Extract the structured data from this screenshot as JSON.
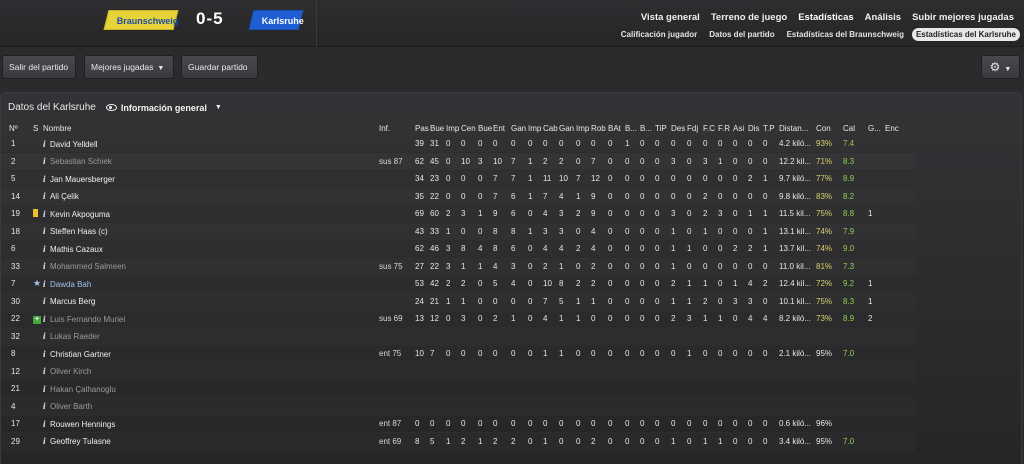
{
  "match": {
    "home_team": "Braunschweig",
    "away_team": "Karlsruhe",
    "score": "0-5",
    "home_color": "#e6d337",
    "away_color": "#1f5ed2"
  },
  "nav": {
    "main": [
      "Vista general",
      "Terreno de juego",
      "Estadísticas",
      "Análisis",
      "Subir mejores jugadas"
    ],
    "main_active": "Estadísticas",
    "sub": [
      "Calificación jugador",
      "Datos del partido",
      "Estadísticas del Braunschweig",
      "Estadísticas del Karlsruhe"
    ],
    "sub_active": "Estadísticas del Karlsruhe"
  },
  "toolbar": {
    "exit_label": "Salir del partido",
    "best_plays_label": "Mejores jugadas",
    "save_label": "Guardar partido",
    "settings_icon": "gear-icon"
  },
  "panel": {
    "title": "Datos del Karlsruhe",
    "view_label": "Información general",
    "view_icon": "eye-icon"
  },
  "table": {
    "columns": [
      "Nº",
      "S",
      "Nombre",
      "Inf.",
      "Pas",
      "Bue",
      "Imp",
      "Cen",
      "Bue",
      "Ent",
      "Gan",
      "Imp",
      "Cab",
      "Gan",
      "Imp",
      "Rob",
      "BAt",
      "B...",
      "B...",
      "TiP",
      "Des",
      "Fdj",
      "F.C",
      "F.R",
      "Asi",
      "Dis",
      "T.P",
      "Distan...",
      "Con",
      "Cal",
      "G...",
      "Enc"
    ],
    "rows": [
      {
        "num": "1",
        "status": "",
        "name": "David Yelldell",
        "style": "normal",
        "inf": "",
        "stats": [
          "39",
          "31",
          "0",
          "0",
          "0",
          "0",
          "0",
          "0",
          "0",
          "0",
          "0",
          "0",
          "0",
          "1",
          "0",
          "0",
          "0",
          "0",
          "0",
          "0",
          "0",
          "0",
          "0"
        ],
        "dist": "4.2 kiló...",
        "con": "93%",
        "con_white": false,
        "cal": "7.4",
        "g": "",
        "enc": ""
      },
      {
        "num": "2",
        "status": "",
        "name": "Sebastian Schiek",
        "style": "dim",
        "inf": "sus 87",
        "stats": [
          "62",
          "45",
          "0",
          "10",
          "3",
          "10",
          "7",
          "1",
          "2",
          "2",
          "0",
          "7",
          "0",
          "0",
          "0",
          "0",
          "3",
          "0",
          "3",
          "1",
          "0",
          "0",
          "0"
        ],
        "dist": "12.2 kil...",
        "con": "71%",
        "con_white": false,
        "cal": "8.3",
        "g": "",
        "enc": ""
      },
      {
        "num": "5",
        "status": "",
        "name": "Jan Mauersberger",
        "style": "normal",
        "inf": "",
        "stats": [
          "34",
          "23",
          "0",
          "0",
          "0",
          "7",
          "7",
          "1",
          "11",
          "10",
          "7",
          "12",
          "0",
          "0",
          "0",
          "0",
          "0",
          "0",
          "0",
          "0",
          "0",
          "2",
          "1"
        ],
        "dist": "9.7 kiló...",
        "con": "77%",
        "con_white": false,
        "cal": "8.9",
        "g": "",
        "enc": ""
      },
      {
        "num": "14",
        "status": "",
        "name": "Ali Çelik",
        "style": "normal",
        "inf": "",
        "stats": [
          "35",
          "22",
          "0",
          "0",
          "0",
          "7",
          "6",
          "1",
          "7",
          "4",
          "1",
          "9",
          "0",
          "0",
          "0",
          "0",
          "0",
          "0",
          "2",
          "0",
          "0",
          "0",
          "0"
        ],
        "dist": "9.8 kiló...",
        "con": "83%",
        "con_white": false,
        "cal": "8.2",
        "g": "",
        "enc": ""
      },
      {
        "num": "19",
        "status": "yellow",
        "name": "Kevin Akpoguma",
        "style": "normal",
        "inf": "",
        "stats": [
          "69",
          "60",
          "2",
          "3",
          "1",
          "9",
          "6",
          "0",
          "4",
          "3",
          "2",
          "9",
          "0",
          "0",
          "0",
          "0",
          "3",
          "0",
          "2",
          "3",
          "0",
          "1",
          "1"
        ],
        "dist": "11.5 kil...",
        "con": "75%",
        "con_white": false,
        "cal": "8.8",
        "g": "1",
        "enc": ""
      },
      {
        "num": "18",
        "status": "",
        "name": "Steffen Haas (c)",
        "style": "normal",
        "inf": "",
        "stats": [
          "43",
          "33",
          "1",
          "0",
          "0",
          "8",
          "8",
          "1",
          "3",
          "3",
          "0",
          "4",
          "0",
          "0",
          "0",
          "0",
          "1",
          "0",
          "1",
          "0",
          "0",
          "0",
          "1"
        ],
        "dist": "13.1 kil...",
        "con": "74%",
        "con_white": false,
        "cal": "7.9",
        "g": "",
        "enc": ""
      },
      {
        "num": "6",
        "status": "",
        "name": "Mathis Cazaux",
        "style": "normal",
        "inf": "",
        "stats": [
          "62",
          "46",
          "3",
          "8",
          "4",
          "8",
          "6",
          "0",
          "4",
          "4",
          "2",
          "4",
          "0",
          "0",
          "0",
          "0",
          "1",
          "1",
          "0",
          "0",
          "2",
          "2",
          "1"
        ],
        "dist": "13.7 kil...",
        "con": "74%",
        "con_white": false,
        "cal": "9.0",
        "g": "",
        "enc": ""
      },
      {
        "num": "33",
        "status": "",
        "name": "Mohammed Salmeen",
        "style": "dim",
        "inf": "sus 75",
        "stats": [
          "27",
          "22",
          "3",
          "1",
          "1",
          "4",
          "3",
          "0",
          "2",
          "1",
          "0",
          "2",
          "0",
          "0",
          "0",
          "0",
          "1",
          "0",
          "0",
          "0",
          "0",
          "0",
          "0"
        ],
        "dist": "11.0 kil...",
        "con": "81%",
        "con_white": false,
        "cal": "7.3",
        "g": "",
        "enc": ""
      },
      {
        "num": "7",
        "status": "star",
        "name": "Dawda Bah",
        "style": "hl",
        "inf": "",
        "stats": [
          "53",
          "42",
          "2",
          "2",
          "0",
          "5",
          "4",
          "0",
          "10",
          "8",
          "2",
          "2",
          "0",
          "0",
          "0",
          "0",
          "2",
          "1",
          "1",
          "0",
          "1",
          "4",
          "2"
        ],
        "dist": "12.4 kil...",
        "con": "72%",
        "con_white": false,
        "cal": "9.2",
        "g": "1",
        "enc": ""
      },
      {
        "num": "30",
        "status": "",
        "name": "Marcus Berg",
        "style": "normal",
        "inf": "",
        "stats": [
          "24",
          "21",
          "1",
          "1",
          "0",
          "0",
          "0",
          "0",
          "7",
          "5",
          "1",
          "1",
          "0",
          "0",
          "0",
          "0",
          "1",
          "1",
          "2",
          "0",
          "3",
          "3",
          "0"
        ],
        "dist": "10.1 kil...",
        "con": "75%",
        "con_white": false,
        "cal": "8.3",
        "g": "1",
        "enc": ""
      },
      {
        "num": "22",
        "status": "plus",
        "name": "Luis Fernando Muriel",
        "style": "dim",
        "inf": "sus 69",
        "stats": [
          "13",
          "12",
          "0",
          "3",
          "0",
          "2",
          "1",
          "0",
          "4",
          "1",
          "1",
          "0",
          "0",
          "0",
          "0",
          "0",
          "2",
          "3",
          "1",
          "1",
          "0",
          "4",
          "4"
        ],
        "dist": "8.2 kiló...",
        "con": "73%",
        "con_white": false,
        "cal": "8.9",
        "g": "2",
        "enc": ""
      },
      {
        "num": "32",
        "status": "",
        "name": "Lukas Raeder",
        "style": "dim",
        "inf": "",
        "stats": [
          "",
          "",
          "",
          "",
          "",
          "",
          "",
          "",
          "",
          "",
          "",
          "",
          "",
          "",
          "",
          "",
          "",
          "",
          "",
          "",
          "",
          "",
          ""
        ],
        "dist": "",
        "con": "",
        "con_white": true,
        "cal": "",
        "g": "",
        "enc": ""
      },
      {
        "num": "8",
        "status": "",
        "name": "Christian Gartner",
        "style": "normal",
        "inf": "ent 75",
        "stats": [
          "10",
          "7",
          "0",
          "0",
          "0",
          "0",
          "0",
          "0",
          "1",
          "1",
          "0",
          "0",
          "0",
          "0",
          "0",
          "0",
          "0",
          "1",
          "0",
          "0",
          "0",
          "0",
          "0"
        ],
        "dist": "2.1 kiló...",
        "con": "95%",
        "con_white": true,
        "cal": "7.0",
        "g": "",
        "enc": ""
      },
      {
        "num": "12",
        "status": "",
        "name": "Oliver Kirch",
        "style": "dim",
        "inf": "",
        "stats": [
          "",
          "",
          "",
          "",
          "",
          "",
          "",
          "",
          "",
          "",
          "",
          "",
          "",
          "",
          "",
          "",
          "",
          "",
          "",
          "",
          "",
          "",
          ""
        ],
        "dist": "",
        "con": "",
        "con_white": true,
        "cal": "",
        "g": "",
        "enc": ""
      },
      {
        "num": "21",
        "status": "",
        "name": "Hakan Çalhanoglu",
        "style": "dim",
        "inf": "",
        "stats": [
          "",
          "",
          "",
          "",
          "",
          "",
          "",
          "",
          "",
          "",
          "",
          "",
          "",
          "",
          "",
          "",
          "",
          "",
          "",
          "",
          "",
          "",
          ""
        ],
        "dist": "",
        "con": "",
        "con_white": true,
        "cal": "",
        "g": "",
        "enc": ""
      },
      {
        "num": "4",
        "status": "",
        "name": "Oliver Barth",
        "style": "dim",
        "inf": "",
        "stats": [
          "",
          "",
          "",
          "",
          "",
          "",
          "",
          "",
          "",
          "",
          "",
          "",
          "",
          "",
          "",
          "",
          "",
          "",
          "",
          "",
          "",
          "",
          ""
        ],
        "dist": "",
        "con": "",
        "con_white": true,
        "cal": "",
        "g": "",
        "enc": ""
      },
      {
        "num": "17",
        "status": "",
        "name": "Rouwen Hennings",
        "style": "normal",
        "inf": "ent 87",
        "stats": [
          "0",
          "0",
          "0",
          "0",
          "0",
          "0",
          "0",
          "0",
          "0",
          "0",
          "0",
          "0",
          "0",
          "0",
          "0",
          "0",
          "0",
          "0",
          "0",
          "0",
          "0",
          "0",
          "0"
        ],
        "dist": "0.6 kiló...",
        "con": "96%",
        "con_white": true,
        "cal": "",
        "g": "",
        "enc": ""
      },
      {
        "num": "29",
        "status": "",
        "name": "Geoffrey Tulasne",
        "style": "normal",
        "inf": "ent 69",
        "stats": [
          "8",
          "5",
          "1",
          "2",
          "1",
          "2",
          "2",
          "0",
          "1",
          "0",
          "0",
          "2",
          "0",
          "0",
          "0",
          "0",
          "1",
          "0",
          "1",
          "1",
          "0",
          "0",
          "0"
        ],
        "dist": "3.4 kiló...",
        "con": "95%",
        "con_white": true,
        "cal": "7.0",
        "g": "",
        "enc": ""
      }
    ]
  }
}
